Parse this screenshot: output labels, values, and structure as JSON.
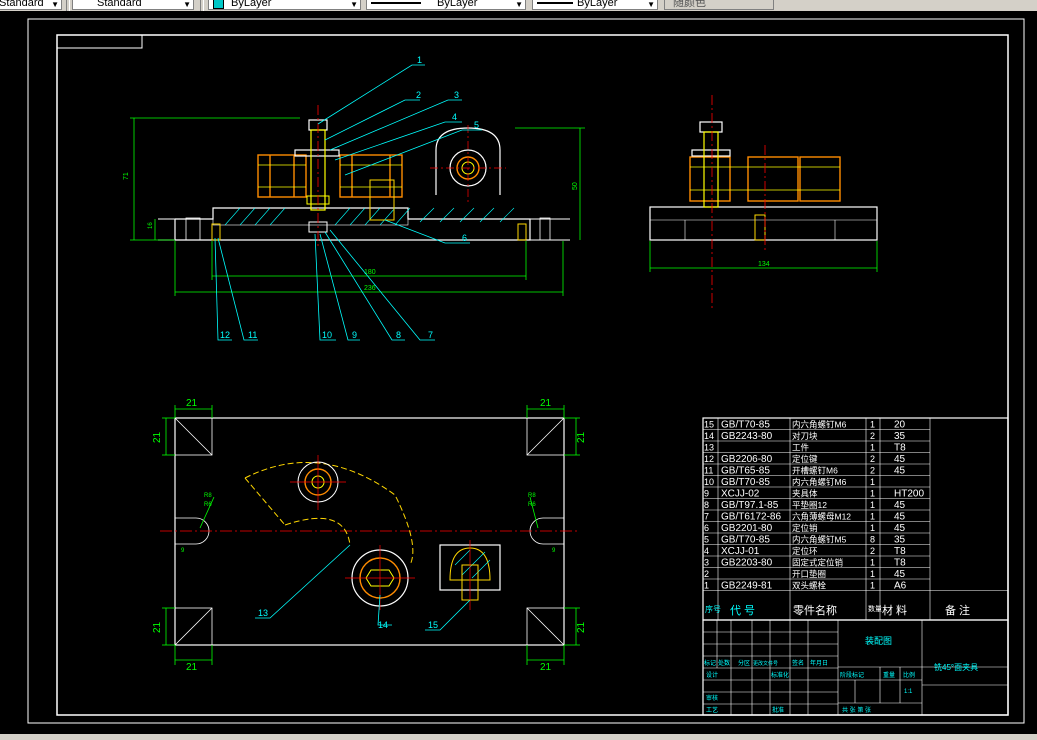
{
  "toolbar": {
    "textstyle_value": "Standard",
    "layer_value": "ByLayer",
    "linetype_value": "ByLayer",
    "lineweight_value": "ByLayer",
    "plotstyle_value": "随颜色"
  },
  "drawing": {
    "balloons_top": [
      "1",
      "2",
      "3",
      "4",
      "5",
      "6",
      "7",
      "8",
      "9",
      "10",
      "11",
      "12"
    ],
    "dims_front": {
      "h_total": "71",
      "h_base": "16",
      "h_right": "50",
      "w_inner": "180",
      "w_total": "236"
    },
    "dim_side": "134",
    "dims_plan": {
      "corner": "21",
      "r_left": "R8",
      "r_left2": "R6",
      "r_right": "R8",
      "r_right2": "R6",
      "slot": "9"
    },
    "balloons_plan": [
      "13",
      "14",
      "15"
    ]
  },
  "bom": {
    "rows": [
      {
        "no": "15",
        "code": "GB/T70-85",
        "name": "内六角螺钉M6",
        "qty": "1",
        "mat": "20",
        "note": ""
      },
      {
        "no": "14",
        "code": "GB2243-80",
        "name": "对刀块",
        "qty": "2",
        "mat": "35",
        "note": ""
      },
      {
        "no": "13",
        "code": "",
        "name": "工件",
        "qty": "1",
        "mat": "T8",
        "note": ""
      },
      {
        "no": "12",
        "code": "GB2206-80",
        "name": "定位键",
        "qty": "2",
        "mat": "45",
        "note": ""
      },
      {
        "no": "11",
        "code": "GB/T65-85",
        "name": "开槽螺钉M6",
        "qty": "2",
        "mat": "45",
        "note": ""
      },
      {
        "no": "10",
        "code": "GB/T70-85",
        "name": "内六角螺钉M6",
        "qty": "1",
        "mat": "",
        "note": ""
      },
      {
        "no": "9",
        "code": "XCJJ-02",
        "name": "夹具体",
        "qty": "1",
        "mat": "HT200",
        "note": ""
      },
      {
        "no": "8",
        "code": "GB/T97.1-85",
        "name": "平垫圈12",
        "qty": "1",
        "mat": "45",
        "note": ""
      },
      {
        "no": "7",
        "code": "GB/T6172-86",
        "name": "六角薄螺母M12",
        "qty": "1",
        "mat": "45",
        "note": ""
      },
      {
        "no": "6",
        "code": "GB2201-80",
        "name": "定位销",
        "qty": "1",
        "mat": "45",
        "note": ""
      },
      {
        "no": "5",
        "code": "GB/T70-85",
        "name": "内六角螺钉M5",
        "qty": "8",
        "mat": "35",
        "note": ""
      },
      {
        "no": "4",
        "code": "XCJJ-01",
        "name": "定位环",
        "qty": "2",
        "mat": "T8",
        "note": ""
      },
      {
        "no": "3",
        "code": "GB2203-80",
        "name": "固定式定位销",
        "qty": "1",
        "mat": "T8",
        "note": ""
      },
      {
        "no": "2",
        "code": "",
        "name": "开口垫圈",
        "qty": "1",
        "mat": "45",
        "note": ""
      },
      {
        "no": "1",
        "code": "GB2249-81",
        "name": "双头螺栓",
        "qty": "1",
        "mat": "A6",
        "note": ""
      }
    ],
    "header": {
      "no": "序号",
      "code": "代 号",
      "name": "零件名称",
      "qty": "数量",
      "mat": "材 料",
      "note": "备 注"
    }
  },
  "title_block": {
    "drawing_name": "装配图",
    "part_name": "铣45°面夹具",
    "row_labels": [
      "标记",
      "处数",
      "分区",
      "更改文件号",
      "签名",
      "年月日"
    ],
    "labels": {
      "design": "设计",
      "std": "标准化",
      "review": "审核",
      "process": "工艺",
      "approve": "批准",
      "stage": "阶段标记",
      "weight": "重量",
      "scale": "比例",
      "scale_value": "1:1",
      "sheets": "共 张 第 张"
    }
  },
  "colors": {
    "white": "#ffffff",
    "cyan": "#00ffff",
    "green": "#00ff00",
    "yellow": "#ffff00",
    "red": "#ff0000",
    "orange": "#ff8c00",
    "gold": "#ffd700"
  }
}
